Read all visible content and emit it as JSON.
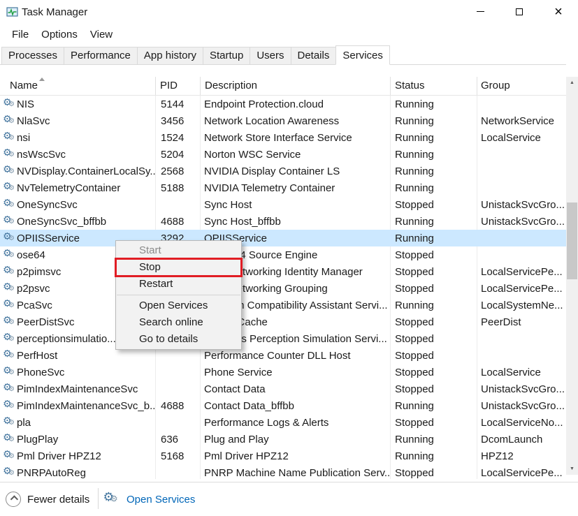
{
  "window": {
    "title": "Task Manager"
  },
  "icons": {
    "close": "×",
    "scroll_up": "▲",
    "scroll_down": "▼",
    "service_gear": "⚙"
  },
  "menu_bar": [
    "File",
    "Options",
    "View"
  ],
  "tabs": [
    {
      "label": "Processes"
    },
    {
      "label": "Performance"
    },
    {
      "label": "App history"
    },
    {
      "label": "Startup"
    },
    {
      "label": "Users"
    },
    {
      "label": "Details"
    },
    {
      "label": "Services",
      "active": true
    }
  ],
  "table": {
    "columns": [
      "Name",
      "PID",
      "Description",
      "Status",
      "Group"
    ],
    "rows": [
      {
        "name": "NIS",
        "pid": "5144",
        "description": "Endpoint Protection.cloud",
        "status": "Running",
        "group": ""
      },
      {
        "name": "NlaSvc",
        "pid": "3456",
        "description": "Network Location Awareness",
        "status": "Running",
        "group": "NetworkService"
      },
      {
        "name": "nsi",
        "pid": "1524",
        "description": "Network Store Interface Service",
        "status": "Running",
        "group": "LocalService"
      },
      {
        "name": "nsWscSvc",
        "pid": "5204",
        "description": "Norton WSC Service",
        "status": "Running",
        "group": ""
      },
      {
        "name": "NVDisplay.ContainerLocalSy...",
        "pid": "2568",
        "description": "NVIDIA Display Container LS",
        "status": "Running",
        "group": ""
      },
      {
        "name": "NvTelemetryContainer",
        "pid": "5188",
        "description": "NVIDIA Telemetry Container",
        "status": "Running",
        "group": ""
      },
      {
        "name": "OneSyncSvc",
        "pid": "",
        "description": "Sync Host",
        "status": "Stopped",
        "group": "UnistackSvcGro..."
      },
      {
        "name": "OneSyncSvc_bffbb",
        "pid": "4688",
        "description": "Sync Host_bffbb",
        "status": "Running",
        "group": "UnistackSvcGro..."
      },
      {
        "name": "OPIISService",
        "pid": "3292",
        "description": "OPIISService",
        "status": "Running",
        "group": "",
        "selected": true
      },
      {
        "name": "ose64",
        "pid": "",
        "description": "Office 64 Source Engine",
        "status": "Stopped",
        "group": ""
      },
      {
        "name": "p2pimsvc",
        "pid": "",
        "description": "Peer Networking Identity Manager",
        "status": "Stopped",
        "group": "LocalServicePe..."
      },
      {
        "name": "p2psvc",
        "pid": "",
        "description": "Peer Networking Grouping",
        "status": "Stopped",
        "group": "LocalServicePe..."
      },
      {
        "name": "PcaSvc",
        "pid": "",
        "description": "Program Compatibility Assistant Servi...",
        "status": "Running",
        "group": "LocalSystemNe..."
      },
      {
        "name": "PeerDistSvc",
        "pid": "",
        "description": "BranchCache",
        "status": "Stopped",
        "group": "PeerDist"
      },
      {
        "name": "perceptionsimulatio...",
        "pid": "",
        "description": "Windows Perception Simulation Servi...",
        "status": "Stopped",
        "group": ""
      },
      {
        "name": "PerfHost",
        "pid": "",
        "description": "Performance Counter DLL Host",
        "status": "Stopped",
        "group": ""
      },
      {
        "name": "PhoneSvc",
        "pid": "",
        "description": "Phone Service",
        "status": "Stopped",
        "group": "LocalService"
      },
      {
        "name": "PimIndexMaintenanceSvc",
        "pid": "",
        "description": "Contact Data",
        "status": "Stopped",
        "group": "UnistackSvcGro..."
      },
      {
        "name": "PimIndexMaintenanceSvc_b...",
        "pid": "4688",
        "description": "Contact Data_bffbb",
        "status": "Running",
        "group": "UnistackSvcGro..."
      },
      {
        "name": "pla",
        "pid": "",
        "description": "Performance Logs & Alerts",
        "status": "Stopped",
        "group": "LocalServiceNo..."
      },
      {
        "name": "PlugPlay",
        "pid": "636",
        "description": "Plug and Play",
        "status": "Running",
        "group": "DcomLaunch"
      },
      {
        "name": "Pml Driver HPZ12",
        "pid": "5168",
        "description": "Pml Driver HPZ12",
        "status": "Running",
        "group": "HPZ12"
      },
      {
        "name": "PNRPAutoReg",
        "pid": "",
        "description": "PNRP Machine Name Publication Serv...",
        "status": "Stopped",
        "group": "LocalServicePe..."
      }
    ]
  },
  "context_menu": {
    "items": [
      {
        "label": "Start",
        "disabled": true
      },
      {
        "label": "Stop",
        "annotated": true
      },
      {
        "label": "Restart"
      },
      {
        "separator": true
      },
      {
        "label": "Open Services"
      },
      {
        "label": "Search online"
      },
      {
        "label": "Go to details"
      }
    ]
  },
  "footer": {
    "fewer_details_label": "Fewer details",
    "open_services_label": "Open Services"
  },
  "colors": {
    "selection": "#cce8ff",
    "link": "#0066b8",
    "annotation": "#e11d24"
  }
}
